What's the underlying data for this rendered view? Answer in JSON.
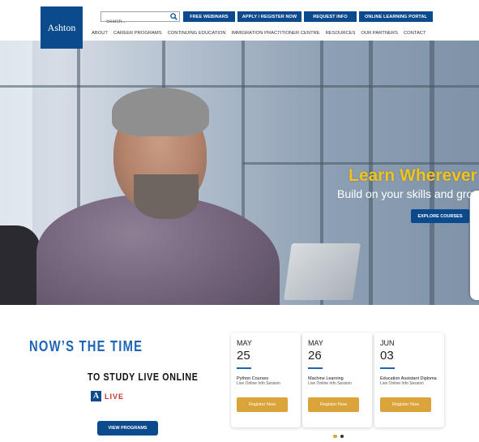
{
  "header": {
    "logo_text": "Ashton",
    "search_placeholder": "Search...",
    "top_buttons": [
      "FREE WEBINARS",
      "APPLY / REGISTER NOW",
      "REQUEST INFO",
      "ONLINE LEARNING PORTAL"
    ],
    "nav": [
      "ABOUT",
      "CAREER PROGRAMS",
      "CONTINUING EDUCATION",
      "IMMIGRATION PRACTITIONER CENTRE",
      "RESOURCES",
      "OUR PARTNERS",
      "CONTACT"
    ]
  },
  "hero": {
    "title": "Learn Wherever Y",
    "subtitle": "Build on your skills and grow",
    "cta": "EXPLORE COURSES"
  },
  "promo": {
    "heading": "NOW’S THE TIME",
    "subheading": "TO STUDY LIVE ONLINE",
    "badge_letter": "A",
    "badge_text": "LIVE",
    "cta": "VIEW PROGRAMS"
  },
  "events": [
    {
      "month": "MAY",
      "day": "25",
      "title": "Python Courses",
      "subtitle": "Live Online Info Session",
      "cta": "Register Now"
    },
    {
      "month": "MAY",
      "day": "26",
      "title": "Machine Learning",
      "subtitle": "Live Online Info Session",
      "cta": "Register Now"
    },
    {
      "month": "JUN",
      "day": "03",
      "title": "Education Assistant Diploma",
      "subtitle": "Live Online Info Session",
      "cta": "Register Now"
    }
  ],
  "colors": {
    "brand": "#0c4a8e",
    "accent": "#dba43a",
    "headline": "#1e64b8",
    "hero_title": "#f2c31b"
  }
}
